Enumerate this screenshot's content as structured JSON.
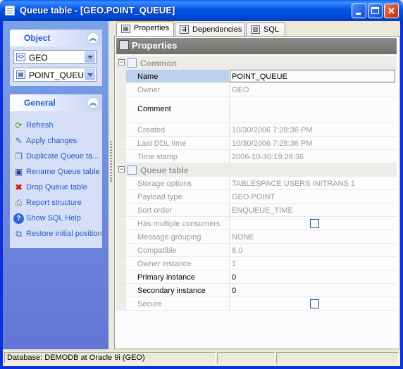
{
  "window": {
    "title": "Queue table - [GEO.POINT_QUEUE]",
    "title_icon": "queue-table-icon",
    "controls": [
      "minimize",
      "maximize",
      "close"
    ]
  },
  "sidebar": {
    "object_group": {
      "title": "Object",
      "schema_combo": {
        "value": "GEO",
        "icon": "schema-icon"
      },
      "object_combo": {
        "value": "POINT_QUEUE",
        "icon": "queue-table-icon"
      }
    },
    "general_group": {
      "title": "General",
      "actions": [
        {
          "label": "Refresh",
          "icon": "refresh-icon"
        },
        {
          "label": "Apply changes",
          "icon": "apply-changes-icon"
        },
        {
          "label": "Duplicate Queue ta...",
          "icon": "duplicate-icon"
        },
        {
          "label": "Rename Queue table",
          "icon": "rename-icon"
        },
        {
          "label": "Drop Queue table",
          "icon": "drop-icon"
        },
        {
          "label": "Report structure",
          "icon": "report-icon"
        },
        {
          "label": "Show SQL Help",
          "icon": "help-icon"
        },
        {
          "label": "Restore initial position",
          "icon": "restore-position-icon"
        }
      ]
    }
  },
  "tabs": [
    {
      "label": "Properties",
      "active": true,
      "icon": "properties-icon"
    },
    {
      "label": "Dependencies",
      "active": false,
      "icon": "dependencies-icon"
    },
    {
      "label": "SQL",
      "active": false,
      "icon": "sql-icon"
    }
  ],
  "properties": {
    "header": "Properties",
    "categories": {
      "common": "Common",
      "queue_table": "Queue table"
    },
    "common": [
      {
        "name": "Name",
        "value": "POINT_QUEUE"
      },
      {
        "name": "Owner",
        "value": "GEO"
      },
      {
        "name": "Comment",
        "value": ""
      },
      {
        "name": "Created",
        "value": "10/30/2006 7:28:36 PM"
      },
      {
        "name": "Last DDL time",
        "value": "10/30/2006 7:28:36 PM"
      },
      {
        "name": "Time stamp",
        "value": "2006-10-30:19:28:36"
      }
    ],
    "queue_table": [
      {
        "name": "Storage options",
        "value": "TABLESPACE USERS INITRANS 1"
      },
      {
        "name": "Payload type",
        "value": "GEO.POINT"
      },
      {
        "name": "Sort order",
        "value": "ENQUEUE_TIME"
      },
      {
        "name": "Has multiple consumers",
        "value": "",
        "checkbox": false
      },
      {
        "name": "Message grouping",
        "value": "NONE"
      },
      {
        "name": "Compatible",
        "value": "8.0"
      },
      {
        "name": "Owner instance",
        "value": "1"
      },
      {
        "name": "Primary instance",
        "value": "0"
      },
      {
        "name": "Secondary instance",
        "value": "0"
      },
      {
        "name": "Secure",
        "value": "",
        "checkbox": false
      }
    ]
  },
  "statusbar": {
    "text": "Database: DEMODB  at Oracle 9i (GEO)"
  }
}
